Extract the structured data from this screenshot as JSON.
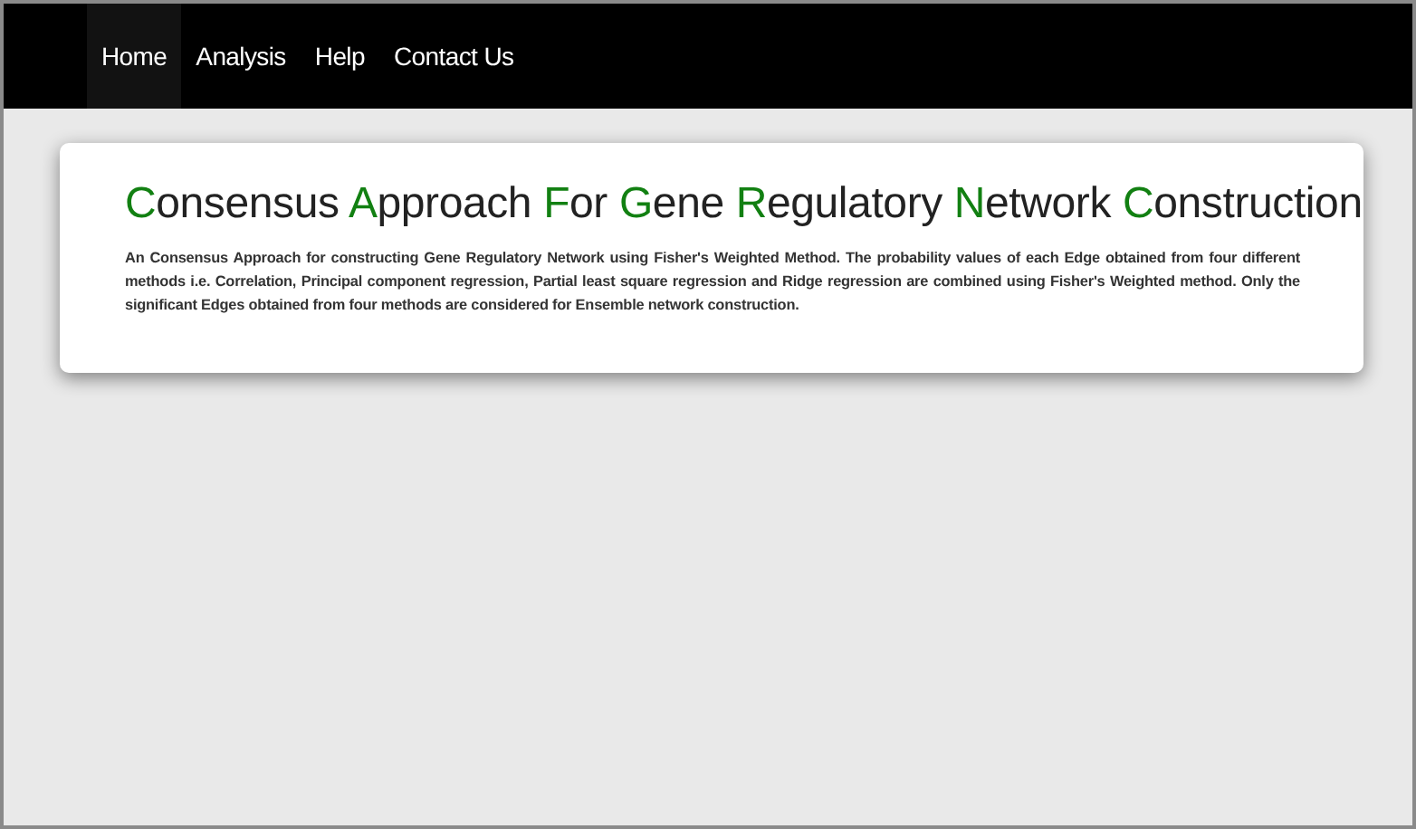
{
  "nav": [
    {
      "label": "Home",
      "selected": true
    },
    {
      "label": "Analysis",
      "selected": false
    },
    {
      "label": "Help",
      "selected": false
    },
    {
      "label": "Contact Us",
      "selected": false
    }
  ],
  "title": [
    {
      "text": "C",
      "accent": true
    },
    {
      "text": "onsensus ",
      "accent": false
    },
    {
      "text": "A",
      "accent": true
    },
    {
      "text": "pproach ",
      "accent": false
    },
    {
      "text": "F",
      "accent": true
    },
    {
      "text": "or ",
      "accent": false
    },
    {
      "text": "G",
      "accent": true
    },
    {
      "text": "ene ",
      "accent": false
    },
    {
      "text": "R",
      "accent": true
    },
    {
      "text": "egulatory ",
      "accent": false
    },
    {
      "text": "N",
      "accent": true
    },
    {
      "text": "etwork ",
      "accent": false
    },
    {
      "text": "C",
      "accent": true
    },
    {
      "text": "onstruction",
      "accent": false
    }
  ],
  "description": "An Consensus Approach for constructing Gene Regulatory Network using Fisher's Weighted Method. The probability values of each Edge obtained from four different methods i.e. Correlation, Principal component regression, Partial least square regression and Ridge regression are combined using Fisher's Weighted method. Only the significant Edges obtained from four methods are considered for Ensemble network construction."
}
